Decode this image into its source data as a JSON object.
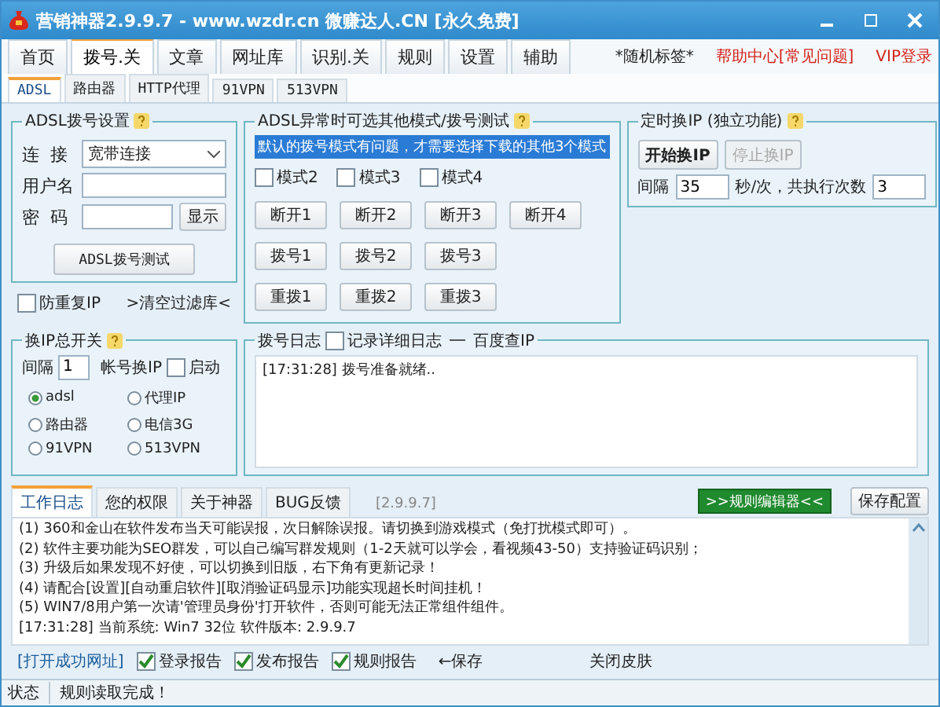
{
  "window": {
    "title": "营销神器2.9.9.7 - www.wzdr.cn 微赚达人.CN [永久免费]"
  },
  "tabs": [
    {
      "label": "首页",
      "selected": false
    },
    {
      "label": "拨号.关",
      "selected": true
    },
    {
      "label": "文章",
      "selected": false
    },
    {
      "label": "网址库",
      "selected": false
    },
    {
      "label": "识别.关",
      "selected": false
    },
    {
      "label": "规则",
      "selected": false
    },
    {
      "label": "设置",
      "selected": false
    },
    {
      "label": "辅助",
      "selected": false
    }
  ],
  "header_links": [
    {
      "kind": "tag",
      "label": "*随机标签*"
    },
    {
      "kind": "link",
      "label": "帮助中心[常见问题]"
    },
    {
      "kind": "link",
      "label": "VIP登录"
    }
  ],
  "subtabs": [
    {
      "label": "ADSL",
      "selected": true
    },
    {
      "label": "路由器",
      "selected": false
    },
    {
      "label": "HTTP代理",
      "selected": false
    },
    {
      "label": "91VPN",
      "selected": false
    },
    {
      "label": "513VPN",
      "selected": false
    }
  ],
  "adsl_settings": {
    "title": "ADSL拨号设置",
    "connection_label": "连  接",
    "connection_value": "宽带连接",
    "username_label": "用户名",
    "password_label": "密  码",
    "show_button": "显示",
    "test_button": "ADSL拨号测试"
  },
  "anti_repeat": {
    "label": "防重复IP",
    "checked": false
  },
  "clear_filter": ">清空过滤库<",
  "modes_group": {
    "title": "ADSL异常时可选其他模式/拨号测试",
    "notice": "默认的拨号模式有问题，才需要选择下载的其他3个模式",
    "modes": [
      {
        "label": "模式2",
        "checked": false
      },
      {
        "label": "模式3",
        "checked": false
      },
      {
        "label": "模式4",
        "checked": false
      }
    ],
    "button_rows": [
      [
        "断开1",
        "断开2",
        "断开3",
        "断开4"
      ],
      [
        "拨号1",
        "拨号2",
        "拨号3"
      ],
      [
        "重拨1",
        "重拨2",
        "重拨3"
      ]
    ]
  },
  "timer_group": {
    "title": "定时换IP (独立功能)",
    "buttons": [
      {
        "label": "开始换IP",
        "disabled": false
      },
      {
        "label": "停止换IP",
        "disabled": true
      }
    ],
    "interval_label": "间隔",
    "interval_value": "35",
    "times_label": "秒/次，共执行次数",
    "times_value": "3"
  },
  "switch_group": {
    "title": "换IP总开关",
    "interval_label": "间隔",
    "interval_value": "1",
    "account_label": "帐号换IP",
    "start": {
      "label": "启动",
      "checked": false
    },
    "options": [
      {
        "label": "adsl",
        "selected": true
      },
      {
        "label": "代理IP",
        "selected": false
      },
      {
        "label": "路由器",
        "selected": false
      },
      {
        "label": "电信3G",
        "selected": false
      },
      {
        "label": "91VPN",
        "selected": false
      },
      {
        "label": "513VPN",
        "selected": false
      }
    ]
  },
  "dial_log": {
    "title": "拨号日志",
    "detail": {
      "label": "记录详细日志",
      "checked": false
    },
    "baidu": "百度查IP",
    "lines": [
      "[17:31:28] 拨号准备就绪.."
    ]
  },
  "bottom_tabs": [
    {
      "label": "工作日志",
      "selected": true
    },
    {
      "label": "您的权限",
      "selected": false
    },
    {
      "label": "关于神器",
      "selected": false
    },
    {
      "label": "BUG反馈",
      "selected": false
    }
  ],
  "version": "[2.9.9.7]",
  "rules_editor_button": ">>规则编辑器<<",
  "save_config_button": "保存配置",
  "work_log": [
    "(1) 360和金山在软件发布当天可能误报，次日解除误报。请切换到游戏模式（免打扰模式即可）。",
    "(2) 软件主要功能为SEO群发，可以自己编写群发规则（1-2天就可以学会，看视频43-50）支持验证码识别；",
    "(3) 升级后如果发现不好使，可以切换到旧版，右下角有更新记录！",
    "(4) 请配合[设置][自动重启软件][取消验证码显示]功能实现超长时间挂机！",
    "(5) WIN7/8用户第一次请'管理员身份'打开软件，否则可能无法正常组件组件。",
    "[17:31:28] 当前系统: Win7 32位 软件版本: 2.9.9.7"
  ],
  "open_url": "[打开成功网址]",
  "reports": [
    {
      "label": "登录报告",
      "checked": true
    },
    {
      "label": "发布报告",
      "checked": true
    },
    {
      "label": "规则报告",
      "checked": true
    }
  ],
  "save_link": "←保存",
  "close_skin": "关闭皮肤",
  "status_bar": {
    "label": "状态",
    "message": "规则读取完成！"
  }
}
